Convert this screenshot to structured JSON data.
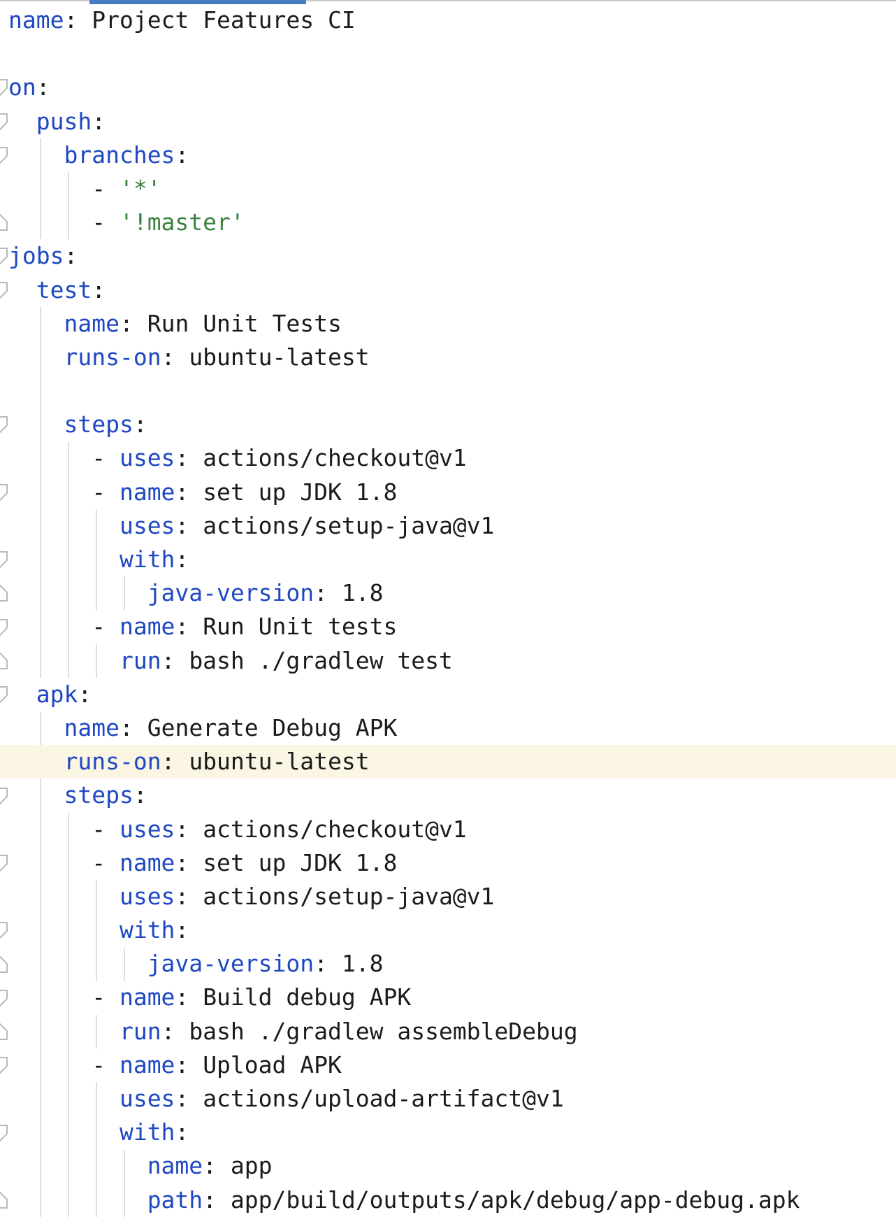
{
  "app": {
    "type": "code-editor",
    "language": "yaml"
  },
  "colors": {
    "key": "#1f48c2",
    "string": "#3c823c",
    "text": "#1b1b1b",
    "current_line_bg": "#faf6e3",
    "indent_guide": "#dedede",
    "fold_icon": "#b9b9b9",
    "tab_indicator": "#4a7cc4",
    "tab_bar_border": "#cbcbcb"
  },
  "code": {
    "lines": [
      {
        "no": 1,
        "fold": null,
        "highlight": false,
        "tokens": [
          [
            "k",
            "name"
          ],
          [
            "p",
            ": "
          ],
          [
            "v",
            "Project Features CI"
          ]
        ]
      },
      {
        "no": 2,
        "fold": null,
        "highlight": false,
        "tokens": []
      },
      {
        "no": 3,
        "fold": "start",
        "highlight": false,
        "tokens": [
          [
            "k",
            "on"
          ],
          [
            "p",
            ":"
          ]
        ]
      },
      {
        "no": 4,
        "fold": "start",
        "highlight": false,
        "tokens": [
          [
            "p",
            "  "
          ],
          [
            "k",
            "push"
          ],
          [
            "p",
            ":"
          ]
        ]
      },
      {
        "no": 5,
        "fold": "start",
        "highlight": false,
        "tokens": [
          [
            "p",
            "    "
          ],
          [
            "k",
            "branches"
          ],
          [
            "p",
            ":"
          ]
        ]
      },
      {
        "no": 6,
        "fold": null,
        "highlight": false,
        "tokens": [
          [
            "p",
            "      - "
          ],
          [
            "s",
            "'*'"
          ]
        ]
      },
      {
        "no": 7,
        "fold": "end",
        "highlight": false,
        "tokens": [
          [
            "p",
            "      - "
          ],
          [
            "s",
            "'!master'"
          ]
        ]
      },
      {
        "no": 8,
        "fold": "start",
        "highlight": false,
        "tokens": [
          [
            "k",
            "jobs"
          ],
          [
            "p",
            ":"
          ]
        ]
      },
      {
        "no": 9,
        "fold": "start",
        "highlight": false,
        "tokens": [
          [
            "p",
            "  "
          ],
          [
            "k",
            "test"
          ],
          [
            "p",
            ":"
          ]
        ]
      },
      {
        "no": 10,
        "fold": null,
        "highlight": false,
        "tokens": [
          [
            "p",
            "    "
          ],
          [
            "k",
            "name"
          ],
          [
            "p",
            ": "
          ],
          [
            "v",
            "Run Unit Tests"
          ]
        ]
      },
      {
        "no": 11,
        "fold": null,
        "highlight": false,
        "tokens": [
          [
            "p",
            "    "
          ],
          [
            "k",
            "runs-on"
          ],
          [
            "p",
            ": "
          ],
          [
            "v",
            "ubuntu-latest"
          ]
        ]
      },
      {
        "no": 12,
        "fold": null,
        "highlight": false,
        "tokens": []
      },
      {
        "no": 13,
        "fold": "start",
        "highlight": false,
        "tokens": [
          [
            "p",
            "    "
          ],
          [
            "k",
            "steps"
          ],
          [
            "p",
            ":"
          ]
        ]
      },
      {
        "no": 14,
        "fold": null,
        "highlight": false,
        "tokens": [
          [
            "p",
            "      - "
          ],
          [
            "k",
            "uses"
          ],
          [
            "p",
            ": "
          ],
          [
            "v",
            "actions/checkout@v1"
          ]
        ]
      },
      {
        "no": 15,
        "fold": "start",
        "highlight": false,
        "tokens": [
          [
            "p",
            "      - "
          ],
          [
            "k",
            "name"
          ],
          [
            "p",
            ": "
          ],
          [
            "v",
            "set up JDK 1.8"
          ]
        ]
      },
      {
        "no": 16,
        "fold": null,
        "highlight": false,
        "tokens": [
          [
            "p",
            "        "
          ],
          [
            "k",
            "uses"
          ],
          [
            "p",
            ": "
          ],
          [
            "v",
            "actions/setup-java@v1"
          ]
        ]
      },
      {
        "no": 17,
        "fold": "start",
        "highlight": false,
        "tokens": [
          [
            "p",
            "        "
          ],
          [
            "k",
            "with"
          ],
          [
            "p",
            ":"
          ]
        ]
      },
      {
        "no": 18,
        "fold": "end",
        "highlight": false,
        "tokens": [
          [
            "p",
            "          "
          ],
          [
            "k",
            "java-version"
          ],
          [
            "p",
            ": "
          ],
          [
            "v",
            "1.8"
          ]
        ]
      },
      {
        "no": 19,
        "fold": "start",
        "highlight": false,
        "tokens": [
          [
            "p",
            "      - "
          ],
          [
            "k",
            "name"
          ],
          [
            "p",
            ": "
          ],
          [
            "v",
            "Run Unit tests"
          ]
        ]
      },
      {
        "no": 20,
        "fold": "end",
        "highlight": false,
        "tokens": [
          [
            "p",
            "        "
          ],
          [
            "k",
            "run"
          ],
          [
            "p",
            ": "
          ],
          [
            "v",
            "bash ./gradlew test"
          ]
        ]
      },
      {
        "no": 21,
        "fold": "start",
        "highlight": false,
        "tokens": [
          [
            "p",
            "  "
          ],
          [
            "k",
            "apk"
          ],
          [
            "p",
            ":"
          ]
        ]
      },
      {
        "no": 22,
        "fold": null,
        "highlight": false,
        "tokens": [
          [
            "p",
            "    "
          ],
          [
            "k",
            "name"
          ],
          [
            "p",
            ": "
          ],
          [
            "v",
            "Generate Debug APK"
          ]
        ]
      },
      {
        "no": 23,
        "fold": null,
        "highlight": true,
        "tokens": [
          [
            "p",
            "    "
          ],
          [
            "k",
            "runs-on"
          ],
          [
            "p",
            ": "
          ],
          [
            "v",
            "ubuntu-latest"
          ]
        ]
      },
      {
        "no": 24,
        "fold": "start",
        "highlight": false,
        "tokens": [
          [
            "p",
            "    "
          ],
          [
            "k",
            "steps"
          ],
          [
            "p",
            ":"
          ]
        ]
      },
      {
        "no": 25,
        "fold": null,
        "highlight": false,
        "tokens": [
          [
            "p",
            "      - "
          ],
          [
            "k",
            "uses"
          ],
          [
            "p",
            ": "
          ],
          [
            "v",
            "actions/checkout@v1"
          ]
        ]
      },
      {
        "no": 26,
        "fold": "start",
        "highlight": false,
        "tokens": [
          [
            "p",
            "      - "
          ],
          [
            "k",
            "name"
          ],
          [
            "p",
            ": "
          ],
          [
            "v",
            "set up JDK 1.8"
          ]
        ]
      },
      {
        "no": 27,
        "fold": null,
        "highlight": false,
        "tokens": [
          [
            "p",
            "        "
          ],
          [
            "k",
            "uses"
          ],
          [
            "p",
            ": "
          ],
          [
            "v",
            "actions/setup-java@v1"
          ]
        ]
      },
      {
        "no": 28,
        "fold": "start",
        "highlight": false,
        "tokens": [
          [
            "p",
            "        "
          ],
          [
            "k",
            "with"
          ],
          [
            "p",
            ":"
          ]
        ]
      },
      {
        "no": 29,
        "fold": "end",
        "highlight": false,
        "tokens": [
          [
            "p",
            "          "
          ],
          [
            "k",
            "java-version"
          ],
          [
            "p",
            ": "
          ],
          [
            "v",
            "1.8"
          ]
        ]
      },
      {
        "no": 30,
        "fold": "start",
        "highlight": false,
        "tokens": [
          [
            "p",
            "      - "
          ],
          [
            "k",
            "name"
          ],
          [
            "p",
            ": "
          ],
          [
            "v",
            "Build debug APK"
          ]
        ]
      },
      {
        "no": 31,
        "fold": "end",
        "highlight": false,
        "tokens": [
          [
            "p",
            "        "
          ],
          [
            "k",
            "run"
          ],
          [
            "p",
            ": "
          ],
          [
            "v",
            "bash ./gradlew assembleDebug"
          ]
        ]
      },
      {
        "no": 32,
        "fold": "start",
        "highlight": false,
        "tokens": [
          [
            "p",
            "      - "
          ],
          [
            "k",
            "name"
          ],
          [
            "p",
            ": "
          ],
          [
            "v",
            "Upload APK"
          ]
        ]
      },
      {
        "no": 33,
        "fold": null,
        "highlight": false,
        "tokens": [
          [
            "p",
            "        "
          ],
          [
            "k",
            "uses"
          ],
          [
            "p",
            ": "
          ],
          [
            "v",
            "actions/upload-artifact@v1"
          ]
        ]
      },
      {
        "no": 34,
        "fold": "start",
        "highlight": false,
        "tokens": [
          [
            "p",
            "        "
          ],
          [
            "k",
            "with"
          ],
          [
            "p",
            ":"
          ]
        ]
      },
      {
        "no": 35,
        "fold": null,
        "highlight": false,
        "tokens": [
          [
            "p",
            "          "
          ],
          [
            "k",
            "name"
          ],
          [
            "p",
            ": "
          ],
          [
            "v",
            "app"
          ]
        ]
      },
      {
        "no": 36,
        "fold": "end",
        "highlight": false,
        "tokens": [
          [
            "p",
            "          "
          ],
          [
            "k",
            "path"
          ],
          [
            "p",
            ": "
          ],
          [
            "v",
            "app/build/outputs/apk/debug/app-debug.apk"
          ]
        ]
      }
    ],
    "indent_guides": [
      {
        "level": 1,
        "from": 5,
        "to": 7
      },
      {
        "level": 1,
        "from": 10,
        "to": 20
      },
      {
        "level": 1,
        "from": 22,
        "to": 36
      },
      {
        "level": 2,
        "from": 6,
        "to": 7
      },
      {
        "level": 2,
        "from": 14,
        "to": 20
      },
      {
        "level": 2,
        "from": 25,
        "to": 36
      },
      {
        "level": 3,
        "from": 16,
        "to": 18
      },
      {
        "level": 3,
        "from": 20,
        "to": 20
      },
      {
        "level": 3,
        "from": 27,
        "to": 29
      },
      {
        "level": 3,
        "from": 31,
        "to": 31
      },
      {
        "level": 3,
        "from": 33,
        "to": 36
      },
      {
        "level": 4,
        "from": 18,
        "to": 18
      },
      {
        "level": 4,
        "from": 29,
        "to": 29
      },
      {
        "level": 4,
        "from": 35,
        "to": 36
      }
    ]
  }
}
